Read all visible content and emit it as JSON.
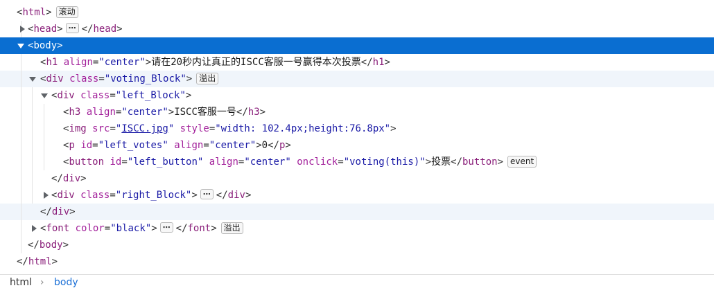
{
  "nodes": {
    "html_open": {
      "tag": "html",
      "badge": "滚动"
    },
    "head": {
      "open": "head",
      "close": "head"
    },
    "body_open": {
      "tag": "body"
    },
    "h1": {
      "tag": "h1",
      "attr1": "align",
      "val1": "\"center\"",
      "text": "请在20秒内让真正的ISCC客服一号赢得本次投票",
      "close": "h1"
    },
    "voting_div": {
      "tag": "div",
      "attr1": "class",
      "val1": "\"voting_Block\"",
      "badge": "溢出"
    },
    "left_div": {
      "tag": "div",
      "attr1": "class",
      "val1": "\"left_Block\""
    },
    "h3": {
      "tag": "h3",
      "attr1": "align",
      "val1": "\"center\"",
      "text": "ISCC客服一号",
      "close": "h3"
    },
    "img": {
      "tag": "img",
      "attr1": "src",
      "val1_pre": "\"",
      "val1_link": "ISCC.jpg",
      "val1_post": "\"",
      "attr2": "style",
      "val2": "\"width: 102.4px;height:76.8px\""
    },
    "p": {
      "tag": "p",
      "attr1": "id",
      "val1": "\"left_votes\"",
      "attr2": "align",
      "val2": "\"center\"",
      "text": "0",
      "close": "p"
    },
    "button": {
      "tag": "button",
      "attr1": "id",
      "val1": "\"left_button\"",
      "attr2": "align",
      "val2": "\"center\"",
      "attr3": "onclick",
      "val3": "\"voting(this)\"",
      "text": "投票",
      "close": "button",
      "badge": "event"
    },
    "left_div_close": {
      "close": "div"
    },
    "right_div": {
      "tag": "div",
      "attr1": "class",
      "val1": "\"right_Block\"",
      "close": "div"
    },
    "voting_div_close": {
      "close": "div"
    },
    "font": {
      "tag": "font",
      "attr1": "color",
      "val1": "\"black\"",
      "close": "font",
      "badge": "溢出"
    },
    "body_close": {
      "close": "body"
    },
    "html_close": {
      "close": "html"
    }
  },
  "ellipsis": "⋯",
  "breadcrumb": {
    "item1": "html",
    "item2": "body",
    "separator": "›"
  }
}
